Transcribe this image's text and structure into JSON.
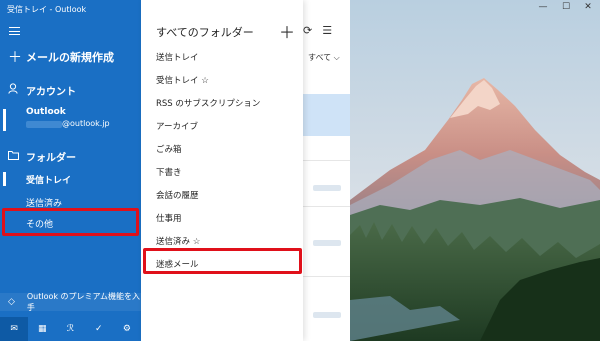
{
  "window": {
    "title": "受信トレイ - Outlook"
  },
  "sidebar": {
    "new_mail": "メールの新規作成",
    "account_header": "アカウント",
    "account": {
      "name": "Outlook",
      "email": "@outlook.jp"
    },
    "folder_header": "フォルダー",
    "folders": [
      {
        "label": "受信トレイ"
      },
      {
        "label": "送信済み"
      },
      {
        "label": "その他"
      }
    ],
    "premium": "Outlook のプレミアム機能を入手",
    "icons": {
      "new_mail": "plus-icon",
      "account": "person-icon",
      "folder": "folder-icon",
      "premium": "diamond-icon"
    }
  },
  "folders_popup": {
    "title": "すべてのフォルダー",
    "items": [
      {
        "label": "送信トレイ"
      },
      {
        "label": "受信トレイ ☆"
      },
      {
        "label": "RSS のサブスクリプション"
      },
      {
        "label": "アーカイブ"
      },
      {
        "label": "ごみ箱"
      },
      {
        "label": "下書き"
      },
      {
        "label": "会話の履歴"
      },
      {
        "label": "仕事用"
      },
      {
        "label": "送信済み ☆"
      },
      {
        "label": "迷惑メール"
      }
    ]
  },
  "message_list": {
    "filter": "すべて"
  },
  "colors": {
    "sidebar_bg": "#1a6fc4",
    "highlight_box": "#e0101a",
    "selected_row": "#cfe3f7"
  }
}
